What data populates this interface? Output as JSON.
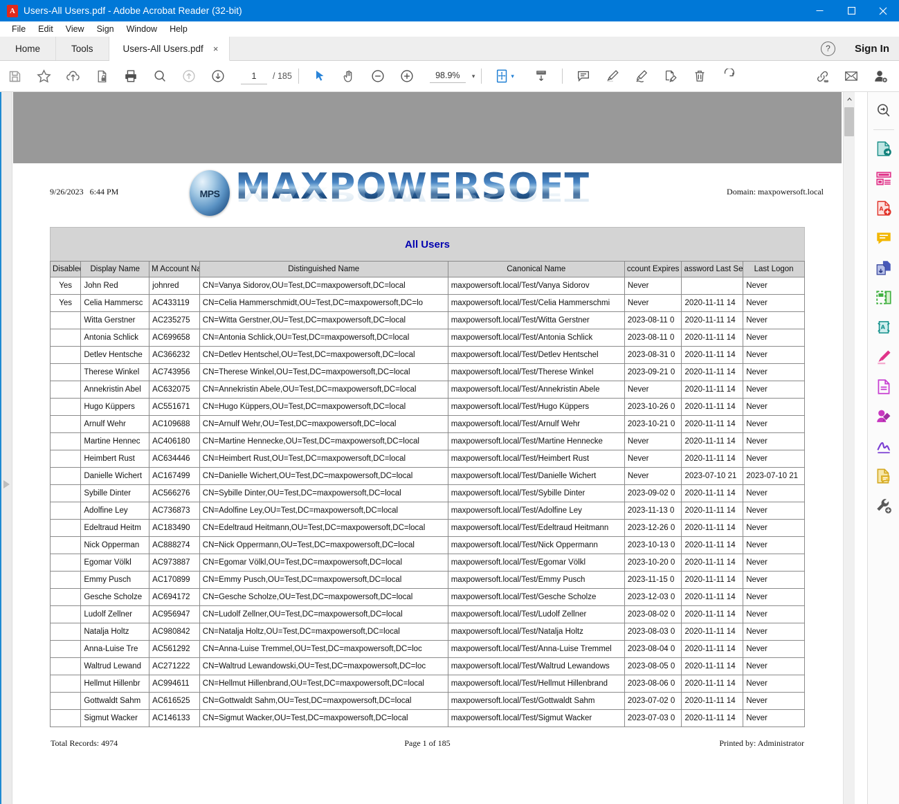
{
  "window": {
    "title": "Users-All Users.pdf - Adobe Acrobat Reader (32-bit)",
    "minimize_label": "Minimize",
    "maximize_label": "Maximize",
    "close_label": "Close"
  },
  "menu": {
    "items": [
      "File",
      "Edit",
      "View",
      "Sign",
      "Window",
      "Help"
    ]
  },
  "tabs": {
    "home": "Home",
    "tools": "Tools",
    "document": "Users-All Users.pdf",
    "close_glyph": "×",
    "help_glyph": "?",
    "sign_in": "Sign In"
  },
  "toolbar": {
    "left_tools": [
      "save-icon",
      "star-icon",
      "upload-cloud-icon",
      "protect-file-icon",
      "print-icon",
      "search-icon",
      "previous-page-icon",
      "next-page-icon"
    ],
    "page_current": "1",
    "page_separator": "/",
    "page_total": "185",
    "select_tool": "select-cursor-icon",
    "hand_tool": "hand-icon",
    "zoom_out": "zoom-out-icon",
    "zoom_in": "zoom-in-icon",
    "zoom_value": "98.9%",
    "zoom_caret": "▾",
    "fit_tool": "page-fit-icon",
    "fit_caret": "▾",
    "scroll_tool": "scroll-mode-icon",
    "right_tools": [
      "comment-icon",
      "highlight-icon",
      "sign-icon",
      "fill-sign-icon",
      "delete-icon",
      "rotate-icon",
      "share-link-icon",
      "email-icon",
      "add-person-icon"
    ]
  },
  "sidebar_right": {
    "tools": [
      "search-document-icon",
      "export-pdf-icon",
      "organize-pages-icon",
      "create-pdf-icon",
      "comment-tool-icon",
      "combine-files-icon",
      "crop-pages-icon",
      "compress-pdf-icon",
      "highlight-tool-icon",
      "page-tool-icon",
      "redact-icon",
      "fill-sign-tool-icon",
      "stamp-icon",
      "more-tools-icon"
    ]
  },
  "sidebar_left": {
    "expand_icon": "expand-panel-arrow-icon"
  },
  "scrollbar": {
    "up_arrow": "scroll-up-arrow-icon"
  },
  "document": {
    "date": "9/26/2023",
    "time": "6:44 PM",
    "domain_label": "Domain:",
    "domain_value": "maxpowersoft.local",
    "logo_text": "MAXPOWERSOFT",
    "logo_badge": "MPS",
    "report_title": "All Users",
    "columns": [
      "Disabled",
      "Display Name",
      "M Account Na",
      "Distinguished Name",
      "Canonical Name",
      "ccount Expires",
      "assword Last Se",
      "Last Logon"
    ],
    "rows": [
      {
        "disabled": "Yes",
        "display_name": "John Red",
        "account": "johnred",
        "dn": "CN=Vanya Sidorov,OU=Test,DC=maxpowersoft,DC=local",
        "canonical": "maxpowersoft.local/Test/Vanya Sidorov",
        "expires": "Never",
        "pwd_last_set": "",
        "last_logon": "Never"
      },
      {
        "disabled": "Yes",
        "display_name": "Celia Hammersc",
        "account": "AC433119",
        "dn": "CN=Celia Hammerschmidt,OU=Test,DC=maxpowersoft,DC=lo",
        "canonical": "maxpowersoft.local/Test/Celia Hammerschmi",
        "expires": "Never",
        "pwd_last_set": "2020-11-11 14",
        "last_logon": "Never"
      },
      {
        "disabled": "",
        "display_name": "Witta Gerstner",
        "account": "AC235275",
        "dn": "CN=Witta Gerstner,OU=Test,DC=maxpowersoft,DC=local",
        "canonical": "maxpowersoft.local/Test/Witta Gerstner",
        "expires": "2023-08-11 0",
        "pwd_last_set": "2020-11-11 14",
        "last_logon": "Never"
      },
      {
        "disabled": "",
        "display_name": "Antonia Schlick",
        "account": "AC699658",
        "dn": "CN=Antonia Schlick,OU=Test,DC=maxpowersoft,DC=local",
        "canonical": "maxpowersoft.local/Test/Antonia Schlick",
        "expires": "2023-08-11 0",
        "pwd_last_set": "2020-11-11 14",
        "last_logon": "Never"
      },
      {
        "disabled": "",
        "display_name": "Detlev Hentsche",
        "account": "AC366232",
        "dn": "CN=Detlev Hentschel,OU=Test,DC=maxpowersoft,DC=local",
        "canonical": "maxpowersoft.local/Test/Detlev Hentschel",
        "expires": "2023-08-31 0",
        "pwd_last_set": "2020-11-11 14",
        "last_logon": "Never"
      },
      {
        "disabled": "",
        "display_name": "Therese Winkel",
        "account": "AC743956",
        "dn": "CN=Therese Winkel,OU=Test,DC=maxpowersoft,DC=local",
        "canonical": "maxpowersoft.local/Test/Therese Winkel",
        "expires": "2023-09-21 0",
        "pwd_last_set": "2020-11-11 14",
        "last_logon": "Never"
      },
      {
        "disabled": "",
        "display_name": "Annekristin Abel",
        "account": "AC632075",
        "dn": "CN=Annekristin Abele,OU=Test,DC=maxpowersoft,DC=local",
        "canonical": "maxpowersoft.local/Test/Annekristin Abele",
        "expires": "Never",
        "pwd_last_set": "2020-11-11 14",
        "last_logon": "Never"
      },
      {
        "disabled": "",
        "display_name": "Hugo Küppers",
        "account": "AC551671",
        "dn": "CN=Hugo Küppers,OU=Test,DC=maxpowersoft,DC=local",
        "canonical": "maxpowersoft.local/Test/Hugo Küppers",
        "expires": "2023-10-26 0",
        "pwd_last_set": "2020-11-11 14",
        "last_logon": "Never"
      },
      {
        "disabled": "",
        "display_name": "Arnulf Wehr",
        "account": "AC109688",
        "dn": "CN=Arnulf Wehr,OU=Test,DC=maxpowersoft,DC=local",
        "canonical": "maxpowersoft.local/Test/Arnulf Wehr",
        "expires": "2023-10-21 0",
        "pwd_last_set": "2020-11-11 14",
        "last_logon": "Never"
      },
      {
        "disabled": "",
        "display_name": "Martine Hennec",
        "account": "AC406180",
        "dn": "CN=Martine Hennecke,OU=Test,DC=maxpowersoft,DC=local",
        "canonical": "maxpowersoft.local/Test/Martine Hennecke",
        "expires": "Never",
        "pwd_last_set": "2020-11-11 14",
        "last_logon": "Never"
      },
      {
        "disabled": "",
        "display_name": "Heimbert Rust",
        "account": "AC634446",
        "dn": "CN=Heimbert Rust,OU=Test,DC=maxpowersoft,DC=local",
        "canonical": "maxpowersoft.local/Test/Heimbert Rust",
        "expires": "Never",
        "pwd_last_set": "2020-11-11 14",
        "last_logon": "Never"
      },
      {
        "disabled": "",
        "display_name": "Danielle Wichert",
        "account": "AC167499",
        "dn": "CN=Danielle Wichert,OU=Test,DC=maxpowersoft,DC=local",
        "canonical": "maxpowersoft.local/Test/Danielle Wichert",
        "expires": "Never",
        "pwd_last_set": "2023-07-10 21",
        "last_logon": "2023-07-10 21"
      },
      {
        "disabled": "",
        "display_name": "Sybille Dinter",
        "account": "AC566276",
        "dn": "CN=Sybille Dinter,OU=Test,DC=maxpowersoft,DC=local",
        "canonical": "maxpowersoft.local/Test/Sybille Dinter",
        "expires": "2023-09-02 0",
        "pwd_last_set": "2020-11-11 14",
        "last_logon": "Never"
      },
      {
        "disabled": "",
        "display_name": "Adolfine Ley",
        "account": "AC736873",
        "dn": "CN=Adolfine Ley,OU=Test,DC=maxpowersoft,DC=local",
        "canonical": "maxpowersoft.local/Test/Adolfine Ley",
        "expires": "2023-11-13 0",
        "pwd_last_set": "2020-11-11 14",
        "last_logon": "Never"
      },
      {
        "disabled": "",
        "display_name": "Edeltraud Heitm",
        "account": "AC183490",
        "dn": "CN=Edeltraud Heitmann,OU=Test,DC=maxpowersoft,DC=local",
        "canonical": "maxpowersoft.local/Test/Edeltraud Heitmann",
        "expires": "2023-12-26 0",
        "pwd_last_set": "2020-11-11 14",
        "last_logon": "Never"
      },
      {
        "disabled": "",
        "display_name": "Nick Opperman",
        "account": "AC888274",
        "dn": "CN=Nick Oppermann,OU=Test,DC=maxpowersoft,DC=local",
        "canonical": "maxpowersoft.local/Test/Nick Oppermann",
        "expires": "2023-10-13 0",
        "pwd_last_set": "2020-11-11 14",
        "last_logon": "Never"
      },
      {
        "disabled": "",
        "display_name": "Egomar Völkl",
        "account": "AC973887",
        "dn": "CN=Egomar Völkl,OU=Test,DC=maxpowersoft,DC=local",
        "canonical": "maxpowersoft.local/Test/Egomar Völkl",
        "expires": "2023-10-20 0",
        "pwd_last_set": "2020-11-11 14",
        "last_logon": "Never"
      },
      {
        "disabled": "",
        "display_name": "Emmy Pusch",
        "account": "AC170899",
        "dn": "CN=Emmy Pusch,OU=Test,DC=maxpowersoft,DC=local",
        "canonical": "maxpowersoft.local/Test/Emmy Pusch",
        "expires": "2023-11-15 0",
        "pwd_last_set": "2020-11-11 14",
        "last_logon": "Never"
      },
      {
        "disabled": "",
        "display_name": "Gesche Scholze",
        "account": "AC694172",
        "dn": "CN=Gesche Scholze,OU=Test,DC=maxpowersoft,DC=local",
        "canonical": "maxpowersoft.local/Test/Gesche Scholze",
        "expires": "2023-12-03 0",
        "pwd_last_set": "2020-11-11 14",
        "last_logon": "Never"
      },
      {
        "disabled": "",
        "display_name": "Ludolf Zellner",
        "account": "AC956947",
        "dn": "CN=Ludolf Zellner,OU=Test,DC=maxpowersoft,DC=local",
        "canonical": "maxpowersoft.local/Test/Ludolf Zellner",
        "expires": "2023-08-02 0",
        "pwd_last_set": "2020-11-11 14",
        "last_logon": "Never"
      },
      {
        "disabled": "",
        "display_name": "Natalja Holtz",
        "account": "AC980842",
        "dn": "CN=Natalja Holtz,OU=Test,DC=maxpowersoft,DC=local",
        "canonical": "maxpowersoft.local/Test/Natalja Holtz",
        "expires": "2023-08-03 0",
        "pwd_last_set": "2020-11-11 14",
        "last_logon": "Never"
      },
      {
        "disabled": "",
        "display_name": "Anna-Luise Tre",
        "account": "AC561292",
        "dn": "CN=Anna-Luise Tremmel,OU=Test,DC=maxpowersoft,DC=loc",
        "canonical": "maxpowersoft.local/Test/Anna-Luise Tremmel",
        "expires": "2023-08-04 0",
        "pwd_last_set": "2020-11-11 14",
        "last_logon": "Never"
      },
      {
        "disabled": "",
        "display_name": "Waltrud Lewand",
        "account": "AC271222",
        "dn": "CN=Waltrud Lewandowski,OU=Test,DC=maxpowersoft,DC=loc",
        "canonical": "maxpowersoft.local/Test/Waltrud Lewandows",
        "expires": "2023-08-05 0",
        "pwd_last_set": "2020-11-11 14",
        "last_logon": "Never"
      },
      {
        "disabled": "",
        "display_name": "Hellmut Hillenbr",
        "account": "AC994611",
        "dn": "CN=Hellmut Hillenbrand,OU=Test,DC=maxpowersoft,DC=local",
        "canonical": "maxpowersoft.local/Test/Hellmut Hillenbrand",
        "expires": "2023-08-06 0",
        "pwd_last_set": "2020-11-11 14",
        "last_logon": "Never"
      },
      {
        "disabled": "",
        "display_name": "Gottwaldt Sahm",
        "account": "AC616525",
        "dn": "CN=Gottwaldt Sahm,OU=Test,DC=maxpowersoft,DC=local",
        "canonical": "maxpowersoft.local/Test/Gottwaldt Sahm",
        "expires": "2023-07-02 0",
        "pwd_last_set": "2020-11-11 14",
        "last_logon": "Never"
      },
      {
        "disabled": "",
        "display_name": "Sigmut Wacker",
        "account": "AC146133",
        "dn": "CN=Sigmut Wacker,OU=Test,DC=maxpowersoft,DC=local",
        "canonical": "maxpowersoft.local/Test/Sigmut Wacker",
        "expires": "2023-07-03 0",
        "pwd_last_set": "2020-11-11 14",
        "last_logon": "Never"
      }
    ],
    "footer": {
      "total_records": "Total Records: 4974",
      "page_of": "Page  1 of 185",
      "printed_by": "Printed by:  Administrator"
    }
  },
  "colors": {
    "titlebar": "#0078d7",
    "accent": "#1f8ad2",
    "report_title": "#0000b0",
    "band": "#d4d4d4",
    "gray_top": "#999999"
  }
}
